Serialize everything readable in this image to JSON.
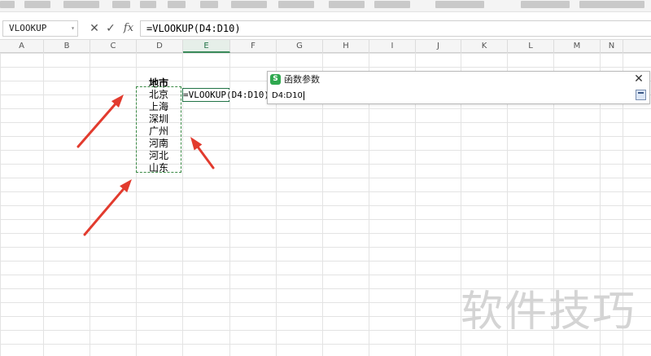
{
  "formula_bar": {
    "name_box": "VLOOKUP",
    "cancel_symbol": "✕",
    "confirm_symbol": "✓",
    "fx_symbol": "fx",
    "formula": "=VLOOKUP(D4:D10)"
  },
  "columns": [
    "A",
    "B",
    "C",
    "D",
    "E",
    "F",
    "G",
    "H",
    "I",
    "J",
    "K",
    "L",
    "M",
    "N"
  ],
  "active_column": "E",
  "cells": {
    "header": "地市",
    "cities": [
      "北京",
      "上海",
      "深圳",
      "广州",
      "河南",
      "河北",
      "山东"
    ],
    "editing_cell": "=VLOOKUP(D4:D10)"
  },
  "dialog": {
    "title": "函数参数",
    "app_icon": "S",
    "close_symbol": "✕",
    "argument_value": "D4:D10",
    "collapse_icon": "collapse-dialog-icon"
  },
  "annotations": {
    "arrow_color": "#e23b2e"
  },
  "watermark": "软件技巧"
}
